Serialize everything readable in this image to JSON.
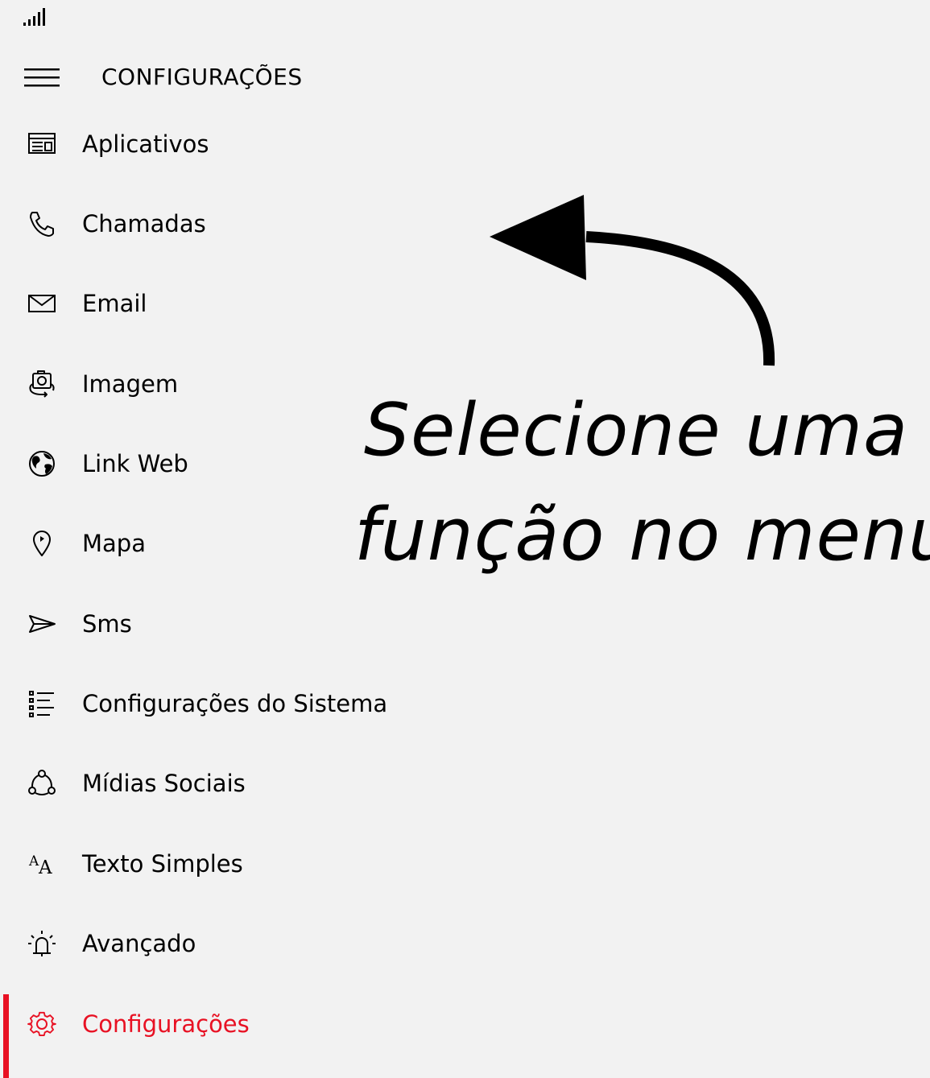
{
  "header": {
    "title": "CONFIGURAÇÕES"
  },
  "menu": {
    "items": [
      {
        "label": "Aplicativos",
        "icon": "apps-icon"
      },
      {
        "label": "Chamadas",
        "icon": "phone-icon"
      },
      {
        "label": "Email",
        "icon": "mail-icon"
      },
      {
        "label": "Imagem",
        "icon": "image-icon"
      },
      {
        "label": "Link Web",
        "icon": "globe-icon"
      },
      {
        "label": "Mapa",
        "icon": "map-pin-icon"
      },
      {
        "label": "Sms",
        "icon": "send-icon"
      },
      {
        "label": "Configurações do Sistema",
        "icon": "list-icon"
      },
      {
        "label": "Mídias Sociais",
        "icon": "social-icon"
      },
      {
        "label": "Texto Simples",
        "icon": "font-size-icon"
      },
      {
        "label": "Avançado",
        "icon": "alarm-icon"
      },
      {
        "label": "Configurações",
        "icon": "gear-icon",
        "active": true
      }
    ]
  },
  "annotation": {
    "line1": "Selecione uma",
    "line2": "função no menu"
  },
  "colors": {
    "background": "#f2f2f2",
    "accent": "#e81123",
    "text": "#000000"
  }
}
